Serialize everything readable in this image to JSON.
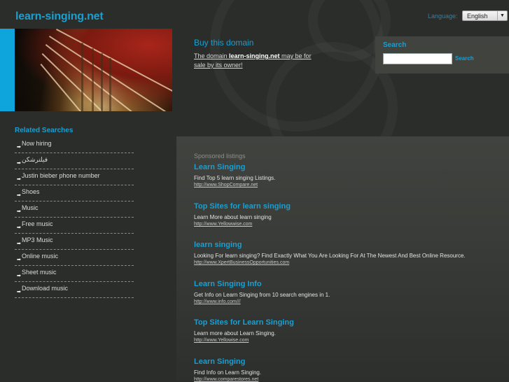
{
  "header": {
    "logo": "learn-singing.net",
    "language_label": "Language:",
    "language_selected": "English"
  },
  "buy_domain": {
    "title": "Buy this domain",
    "text_prefix": "The domain ",
    "domain": "learn-singing.net",
    "text_suffix": " may be for sale by its owner!"
  },
  "search": {
    "title": "Search",
    "input_value": "",
    "button_label": "Search"
  },
  "related": {
    "title": "Related Searches",
    "items": [
      {
        "label": "Now hiring"
      },
      {
        "label": "فیلترشکن"
      },
      {
        "label": "Justin bieber phone number"
      },
      {
        "label": "Shoes"
      },
      {
        "label": "Music"
      },
      {
        "label": "Free music"
      },
      {
        "label": "MP3 Music"
      },
      {
        "label": "Online music"
      },
      {
        "label": "Sheet music"
      },
      {
        "label": "Download music"
      }
    ]
  },
  "sponsored": {
    "label": "Sponsored listings",
    "ads": [
      {
        "title": "Learn Singing",
        "desc": "Find Top 5 learn singing Listings.",
        "url": "http://www.ShopCompare.net"
      },
      {
        "title": "Top Sites for learn singing",
        "desc": "Learn More about learn singing",
        "url": "http://www.Yellowwise.com"
      },
      {
        "title": "learn singing",
        "desc": "Looking For learn singing? Find Exactly What You Are Looking For At The Newest And Best Online Resource.",
        "url": "http://www.XpertBusinessOpportunities.com"
      },
      {
        "title": "Learn Singing Info",
        "desc": "Get Info on Learn Singing from 10 search engines in 1.",
        "url": "http://www.info.com///"
      },
      {
        "title": "Top Sites for Learn Singing",
        "desc": "Learn more about Learn Singing.",
        "url": "http://www.Yellowise.com"
      },
      {
        "title": "Learn Singing",
        "desc": "Find Info on Learn Singing.",
        "url": "http://www.comparestores.net"
      }
    ]
  }
}
